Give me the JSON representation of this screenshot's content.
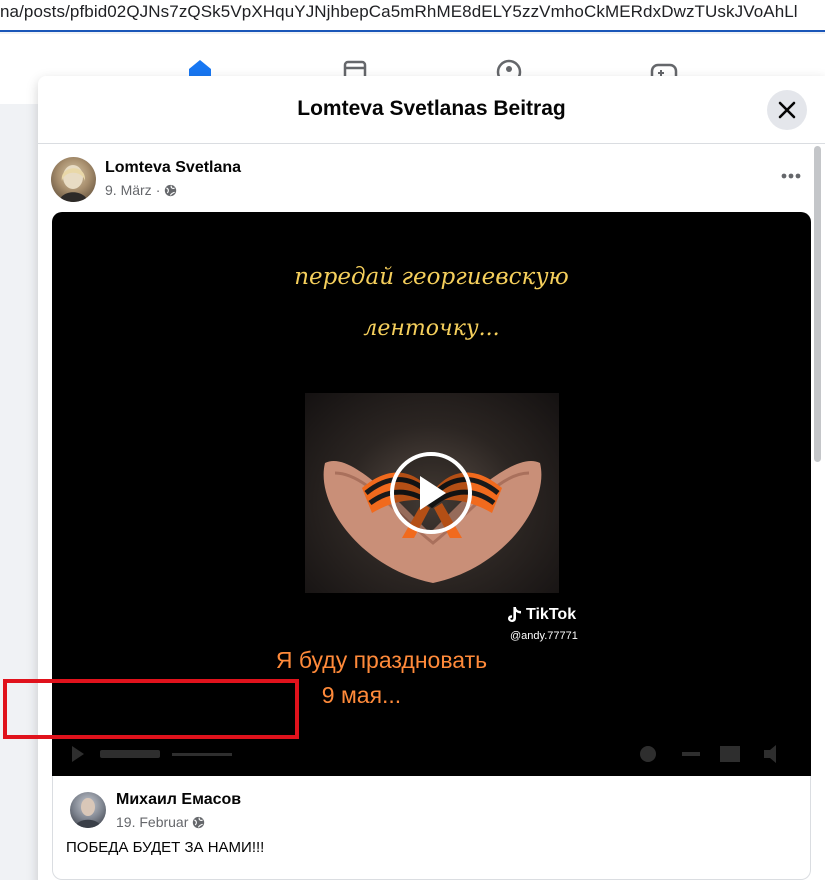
{
  "browser": {
    "url": "na/posts/pfbid02QJNs7zQSk5VpXHquYJNjhbepCa5mRhME8dELY5zzVmhoCkMERdxDwzTUskJVoAhLl"
  },
  "nav": {
    "icons": [
      "home-icon",
      "marketplace-icon",
      "groups-icon",
      "gaming-icon"
    ],
    "active_color": "#1877f2"
  },
  "modal": {
    "title": "Lomteva Svetlanas Beitrag",
    "close_icon": "close-icon"
  },
  "post": {
    "author": "Lomteva Svetlana",
    "date": "9. März",
    "separator": "·",
    "privacy_icon": "globe-icon",
    "more_icon": "more-horizontal-icon"
  },
  "video": {
    "text_line1": "передай георгиевскую",
    "text_line2": "ленточку...",
    "text_line3": "Я буду праздновать",
    "text_line4": "9 мая...",
    "watermark_brand": "TikTok",
    "watermark_user": "@andy.77771",
    "play_icon": "play-icon"
  },
  "comment": {
    "author": "Михаил Емасов",
    "date": "19. Februar",
    "text": "ПОБЕДА БУДЕТ ЗА НАМИ!!!",
    "highlight_color": "#e0121c"
  }
}
